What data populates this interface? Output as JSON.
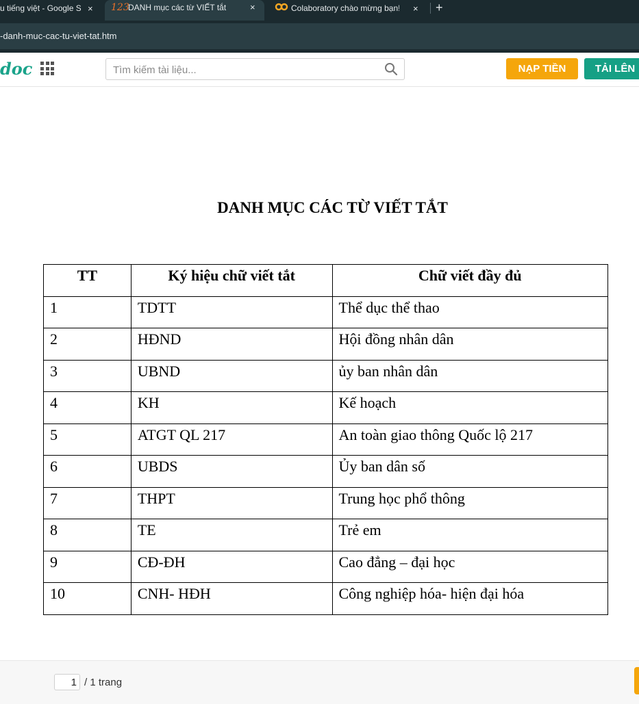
{
  "browser": {
    "tabs": [
      {
        "title": "u tiếng việt - Google S",
        "icon": "google-icon"
      },
      {
        "title": "DANH mục các từ VIẾT tắt",
        "icon_text": "123",
        "active": true
      },
      {
        "title": "Colaboratory chào mừng bạn! -",
        "icon": "colab-icon"
      }
    ],
    "close_glyph": "×",
    "new_tab_glyph": "+",
    "url": "-danh-muc-cac-tu-viet-tat.htm"
  },
  "site": {
    "logo_text": "doc",
    "search_placeholder": "Tìm kiếm tài liệu...",
    "nap_tien_label": "NẠP TIỀN",
    "tai_len_label": "TẢI LÊN",
    "brand_colors": {
      "green": "#16a085",
      "orange": "#f5a60b"
    }
  },
  "document": {
    "title": "DANH MỤC CÁC TỪ VIẾT TẮT",
    "headers": [
      "TT",
      "Ký hiệu chữ viết tắt",
      "Chữ viết đầy đủ"
    ],
    "rows": [
      [
        "1",
        "TDTT",
        "Thể dục thể thao"
      ],
      [
        "2",
        "HĐND",
        "Hội đồng nhân dân"
      ],
      [
        "3",
        "UBND",
        "ủy ban nhân dân"
      ],
      [
        "4",
        "KH",
        "Kế hoạch"
      ],
      [
        "5",
        "ATGT QL 217",
        "An toàn giao thông Quốc lộ 217"
      ],
      [
        "6",
        "UBDS",
        "Ủy ban dân số"
      ],
      [
        "7",
        "THPT",
        "Trung học phổ thông"
      ],
      [
        "8",
        "TE",
        "Trẻ em"
      ],
      [
        "9",
        "CĐ-ĐH",
        "Cao đẳng – đại học"
      ],
      [
        "10",
        "CNH- HĐH",
        "Công nghiệp hóa- hiện đại hóa"
      ]
    ]
  },
  "pager": {
    "current_page": "1",
    "total_label": "/ 1 trang"
  }
}
